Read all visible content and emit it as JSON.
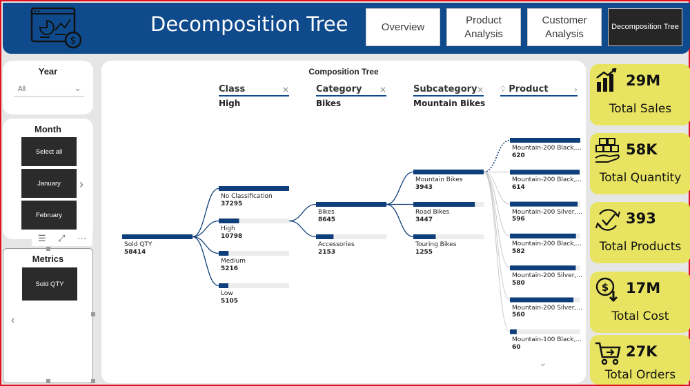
{
  "header": {
    "title": "Decomposition Tree",
    "nav": [
      {
        "label": "Overview",
        "active": false
      },
      {
        "label": "Product Analysis",
        "active": false
      },
      {
        "label": "Customer Analysis",
        "active": false
      },
      {
        "label": "Decomposition Tree",
        "active": true
      }
    ]
  },
  "slicers": {
    "year": {
      "title": "Year",
      "value": "All"
    },
    "month": {
      "title": "Month",
      "items": [
        "Select all",
        "January",
        "February"
      ]
    },
    "metrics": {
      "title": "Metrics",
      "items": [
        "Sold QTY"
      ]
    }
  },
  "tree": {
    "title": "Composition Tree",
    "root": {
      "label": "Sold QTY",
      "value": 58414
    },
    "columns": [
      {
        "field": "Class",
        "selected": "High",
        "removable": true
      },
      {
        "field": "Category",
        "selected": "Bikes",
        "removable": true
      },
      {
        "field": "Subcategory",
        "selected": "Mountain Bikes",
        "removable": true
      },
      {
        "field": "Product",
        "selected": "",
        "removable": false
      }
    ],
    "levels": [
      [
        {
          "label": "No Classification",
          "value": 37295
        },
        {
          "label": "High",
          "value": 10798
        },
        {
          "label": "Medium",
          "value": 5216
        },
        {
          "label": "Low",
          "value": 5105
        }
      ],
      [
        {
          "label": "Bikes",
          "value": 8645
        },
        {
          "label": "Accessories",
          "value": 2153
        }
      ],
      [
        {
          "label": "Mountain Bikes",
          "value": 3943
        },
        {
          "label": "Road Bikes",
          "value": 3447
        },
        {
          "label": "Touring Bikes",
          "value": 1255
        }
      ],
      [
        {
          "label": "Mountain-200 Black,...",
          "value": 620
        },
        {
          "label": "Mountain-200 Black,...",
          "value": 614
        },
        {
          "label": "Mountain-200 Silver,...",
          "value": 596
        },
        {
          "label": "Mountain-200 Black,...",
          "value": 582
        },
        {
          "label": "Mountain-200 Silver,...",
          "value": 580
        },
        {
          "label": "Mountain-200 Silver,...",
          "value": 560
        },
        {
          "label": "Mountain-100 Black,...",
          "value": 60
        }
      ]
    ]
  },
  "kpis": [
    {
      "value": "29M",
      "label": "Total Sales",
      "icon": "bar-chart-icon"
    },
    {
      "value": "58K",
      "label": "Total Quantity",
      "icon": "boxes-hand-icon"
    },
    {
      "value": "393",
      "label": "Total Products",
      "icon": "refresh-check-icon"
    },
    {
      "value": "17M",
      "label": "Total Cost",
      "icon": "dollar-down-icon"
    },
    {
      "value": "27K",
      "label": "Total Orders",
      "icon": "cart-icon"
    }
  ],
  "colors": {
    "header": "#0f4a8c",
    "bar": "#0f3f7a",
    "track": "#ececec",
    "kpi": "#e8e462",
    "active_nav": "#262626"
  }
}
